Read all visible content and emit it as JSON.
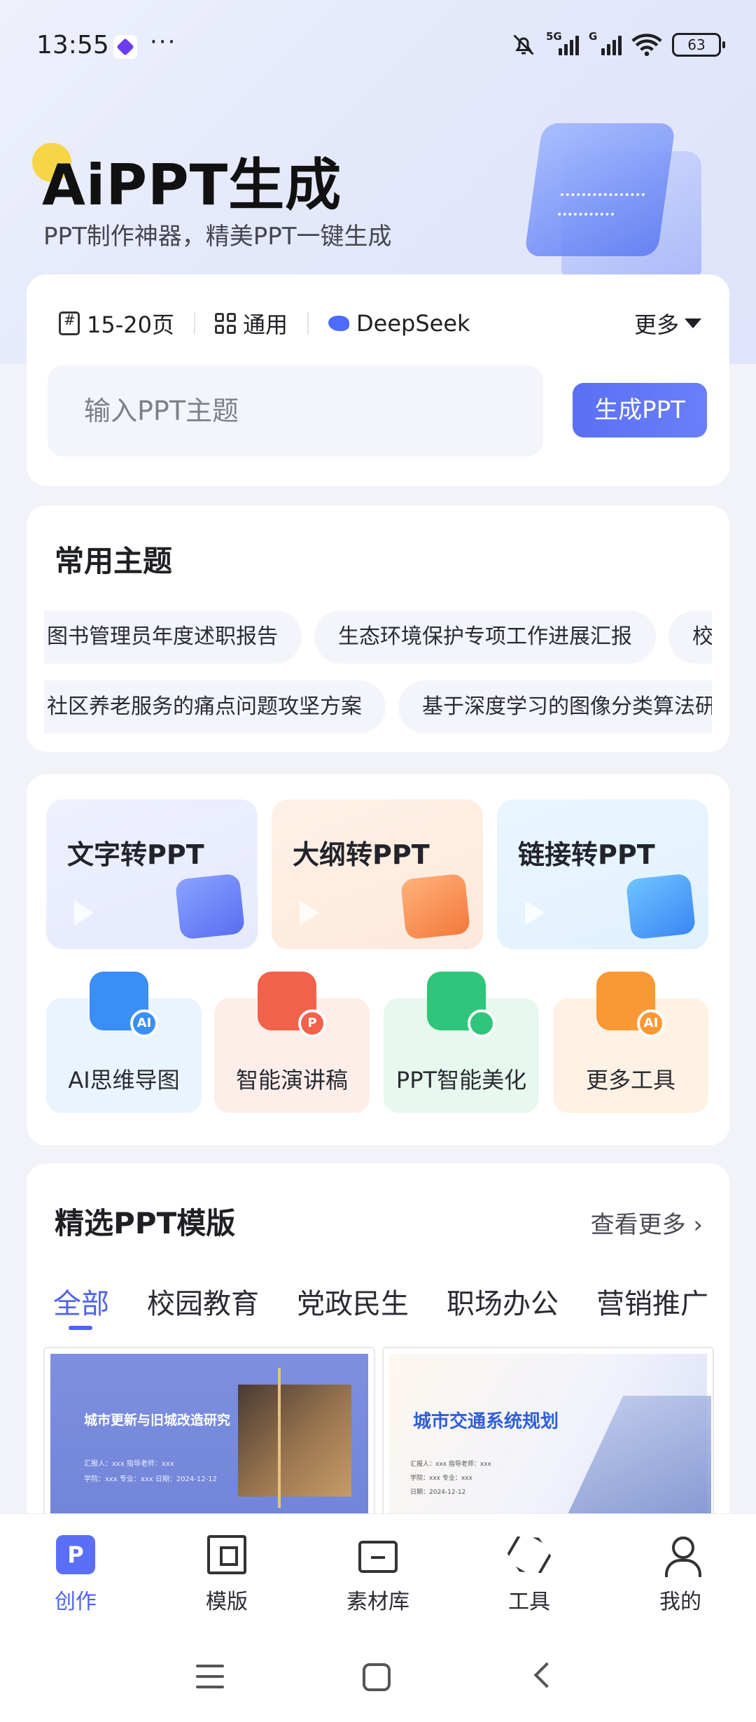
{
  "status_bar": {
    "time": "13:55",
    "dots": "···",
    "network_1": "5G",
    "network_2": "G",
    "battery": "63",
    "icons": [
      "app-icon",
      "mute-bell-icon",
      "signal-icon",
      "wifi-icon",
      "battery-icon"
    ]
  },
  "hero": {
    "title": "AiPPT生成",
    "subtitle": "PPT制作神器，精美PPT一键生成"
  },
  "generator": {
    "page_option": "15-20页",
    "style_option": "通用",
    "model_option": "DeepSeek",
    "more_label": "更多",
    "input_placeholder": "输入PPT主题",
    "input_value": "",
    "generate_label": "生成PPT"
  },
  "topics": {
    "title": "常用主题",
    "row1": [
      "图书管理员年度述职报告",
      "生态环境保护专项工作进展汇报",
      "校园"
    ],
    "row2": [
      "社区养老服务的痛点问题攻坚方案",
      "基于深度学习的图像分类算法研究"
    ]
  },
  "tools": {
    "big": [
      {
        "label": "文字转PPT",
        "icon": "folder-icon"
      },
      {
        "label": "大纲转PPT",
        "icon": "outline-icon"
      },
      {
        "label": "链接转PPT",
        "icon": "link-icon"
      }
    ],
    "small": [
      {
        "label": "AI思维导图",
        "badge": "AI",
        "icon": "mindmap-icon"
      },
      {
        "label": "智能演讲稿",
        "badge": "P",
        "icon": "speaker-icon"
      },
      {
        "label": "PPT智能美化",
        "badge": "",
        "icon": "image-magic-icon"
      },
      {
        "label": "更多工具",
        "badge": "AI",
        "icon": "grid-icon"
      }
    ]
  },
  "templates": {
    "title": "精选PPT模版",
    "see_more": "查看更多",
    "tabs": [
      "全部",
      "校园教育",
      "党政民生",
      "职场办公",
      "营销推广"
    ],
    "active_tab": "全部",
    "items": [
      {
        "heading": "城市更新与旧城改造研究",
        "meta1": "汇报人：xxx        指导老师：xxx",
        "meta2": "学院：xxx    专业：xxx    日期：2024-12-12"
      },
      {
        "heading": "城市交通系统规划",
        "meta1": "汇报人：xxx                    指导老师：xxx",
        "meta2": "学院：xxx                      专业：xxx",
        "meta3": "日期：2024-12-12"
      }
    ]
  },
  "bottom_nav": {
    "items": [
      {
        "label": "创作",
        "icon": "create-icon",
        "glyph": "P"
      },
      {
        "label": "模版",
        "icon": "template-icon"
      },
      {
        "label": "素材库",
        "icon": "folder-icon"
      },
      {
        "label": "工具",
        "icon": "cube-icon"
      },
      {
        "label": "我的",
        "icon": "user-icon"
      }
    ],
    "active": "创作"
  },
  "colors": {
    "accent": "#5b6ff6",
    "background": "#f1f3f8"
  }
}
